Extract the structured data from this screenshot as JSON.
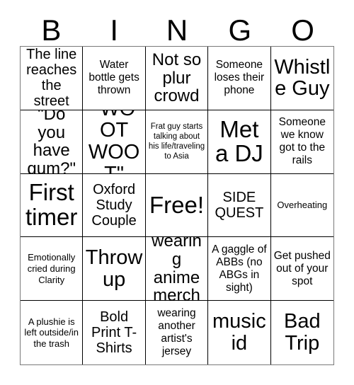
{
  "card": {
    "title": "BINGO Card",
    "header_letters": [
      "B",
      "I",
      "N",
      "G",
      "O"
    ],
    "columns": 5,
    "rows": 5,
    "border_color": "#000000",
    "background_color": "#ffffff",
    "text_color": "#000000",
    "free_space": {
      "row": 3,
      "column": 3,
      "label": "Free!"
    }
  },
  "squares": [
    {
      "text": "The line reaches the street",
      "size": "md",
      "row": 1,
      "column": 1
    },
    {
      "text": "Water bottle gets thrown",
      "size": "sm",
      "row": 1,
      "column": 2
    },
    {
      "text": "Not so plur crowd",
      "size": "lg",
      "row": 1,
      "column": 3
    },
    {
      "text": "Someone loses their phone",
      "size": "sm",
      "row": 1,
      "column": 4
    },
    {
      "text": "Whistle Guy",
      "size": "xl",
      "row": 1,
      "column": 5
    },
    {
      "text": "\"Do you have gum?\"",
      "size": "lg",
      "row": 2,
      "column": 1
    },
    {
      "text": "\"WOOT WOOT\"",
      "size": "xl",
      "row": 2,
      "column": 2
    },
    {
      "text": "Frat guy starts talking about his life/traveling to Asia",
      "size": "xxs",
      "row": 2,
      "column": 3
    },
    {
      "text": "Met a DJ",
      "size": "xxl",
      "row": 2,
      "column": 4
    },
    {
      "text": "Someone we know got to the rails",
      "size": "sm",
      "row": 2,
      "column": 5
    },
    {
      "text": "First timer",
      "size": "xxl",
      "row": 3,
      "column": 1
    },
    {
      "text": "Oxford Study Couple",
      "size": "md",
      "row": 3,
      "column": 2
    },
    {
      "text": "Free!",
      "size": "xxl",
      "row": 3,
      "column": 3
    },
    {
      "text": "SIDE QUEST",
      "size": "md",
      "row": 3,
      "column": 4
    },
    {
      "text": "Overheating",
      "size": "xs",
      "row": 3,
      "column": 5
    },
    {
      "text": "Emotionally cried during Clarity",
      "size": "xs",
      "row": 4,
      "column": 1
    },
    {
      "text": "Throw up",
      "size": "xl",
      "row": 4,
      "column": 2
    },
    {
      "text": "wearing anime merch",
      "size": "lg",
      "row": 4,
      "column": 3
    },
    {
      "text": "A gaggle of ABBs (no ABGs in sight)",
      "size": "sm",
      "row": 4,
      "column": 4
    },
    {
      "text": "Get pushed out of your spot",
      "size": "sm",
      "row": 4,
      "column": 5
    },
    {
      "text": "A plushie is left outside/in the trash",
      "size": "xs",
      "row": 5,
      "column": 1
    },
    {
      "text": "Bold Print T-Shirts",
      "size": "md",
      "row": 5,
      "column": 2
    },
    {
      "text": "wearing another artist's jersey",
      "size": "sm",
      "row": 5,
      "column": 3
    },
    {
      "text": "music id",
      "size": "xl",
      "row": 5,
      "column": 4
    },
    {
      "text": "Bad Trip",
      "size": "xl",
      "row": 5,
      "column": 5
    }
  ]
}
